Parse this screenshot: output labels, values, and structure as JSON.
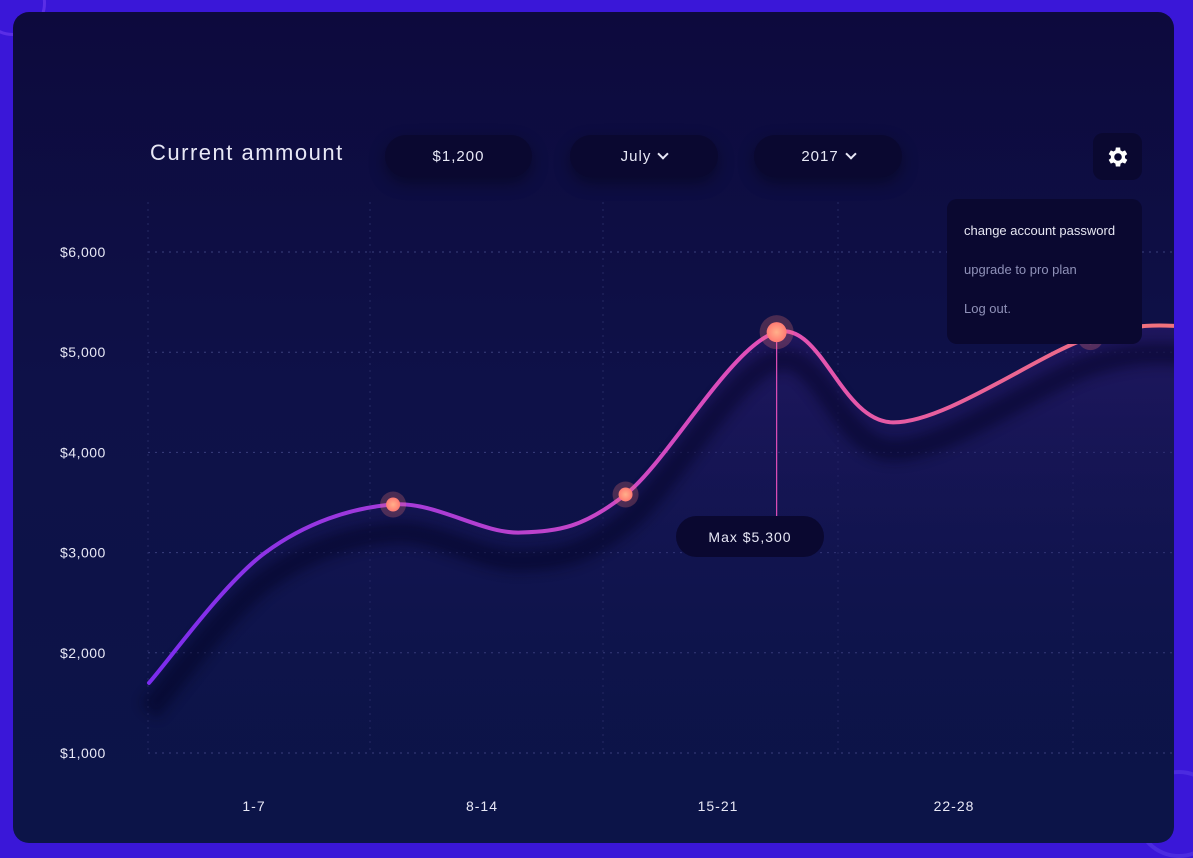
{
  "header": {
    "title": "Current ammount",
    "amount": "$1,200",
    "month": "July",
    "year": "2017"
  },
  "settings_menu": {
    "items": [
      {
        "label": "change account password"
      },
      {
        "label": "upgrade to pro plan"
      },
      {
        "label": "Log out."
      }
    ]
  },
  "tooltip": {
    "label": "Max $5,300"
  },
  "colors": {
    "line_start": "#7b2cf0",
    "line_mid": "#e14fb8",
    "line_end": "#f47a6f",
    "point": "#ff7a72",
    "grid": "#3a3f7c"
  },
  "chart_data": {
    "type": "line",
    "x_categories": [
      "1-7",
      "8-14",
      "15-21",
      "22-28"
    ],
    "y_tick_labels": [
      "$6,000",
      "$5,000",
      "$4,000",
      "$3,000",
      "$2,000",
      "$1,000"
    ],
    "ylim": [
      1000,
      6000
    ],
    "grid": true,
    "series": [
      {
        "values": [
          {
            "x": 0.0,
            "y": 1700
          },
          {
            "x": 0.5,
            "y": 3000
          },
          {
            "x": 1.05,
            "y": 3480
          },
          {
            "x": 1.6,
            "y": 3200
          },
          {
            "x": 2.05,
            "y": 3580
          },
          {
            "x": 2.7,
            "y": 5200
          },
          {
            "x": 3.2,
            "y": 4300
          },
          {
            "x": 4.05,
            "y": 5150
          },
          {
            "x": 4.5,
            "y": 5250
          },
          {
            "x": 4.75,
            "y": 5050
          }
        ],
        "highlighted_points": [
          {
            "x": 1.05,
            "y": 3480
          },
          {
            "x": 2.05,
            "y": 3580
          },
          {
            "x": 2.7,
            "y": 5200
          },
          {
            "x": 4.05,
            "y": 5150
          }
        ],
        "max_point": {
          "x": 2.7,
          "y": 5200
        }
      }
    ]
  }
}
